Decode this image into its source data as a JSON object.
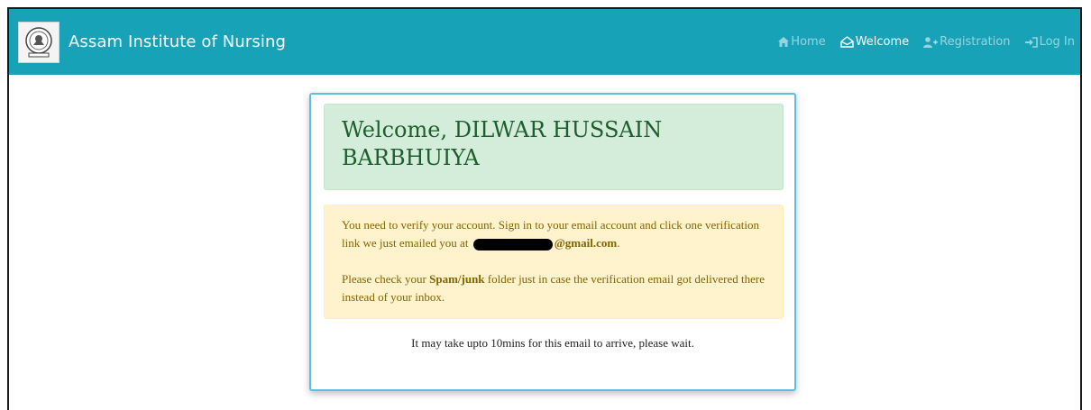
{
  "navbar": {
    "brand_name": "Assam Institute of Nursing",
    "logo_icon": "institute-emblem-icon",
    "background": "#17a2b8",
    "items": [
      {
        "label": "Home",
        "icon": "home-icon",
        "active": false
      },
      {
        "label": "Welcome",
        "icon": "envelope-icon",
        "active": true
      },
      {
        "label": "Registration",
        "icon": "user-plus-icon",
        "active": false
      },
      {
        "label": "Log In",
        "icon": "sign-in-icon",
        "active": false
      }
    ]
  },
  "welcome": {
    "heading": "Welcome, DILWAR HUSSAIN BARBHUIYA"
  },
  "notice": {
    "line1_prefix": "You need to verify your account. Sign in to your email account and click one verification link we just emailed you at",
    "email_suffix": "@gmail.com",
    "line1_end": ".",
    "line2_prefix": "Please check your",
    "line2_bold": "Spam/junk",
    "line2_suffix": "folder just in case the verification email got delivered there instead of your inbox."
  },
  "footer": {
    "text": "It may take upto 10mins for this email to arrive, please wait."
  },
  "colors": {
    "success_bg": "#d4edda",
    "warning_bg": "#fff3cd",
    "card_border": "#5bc0de"
  }
}
